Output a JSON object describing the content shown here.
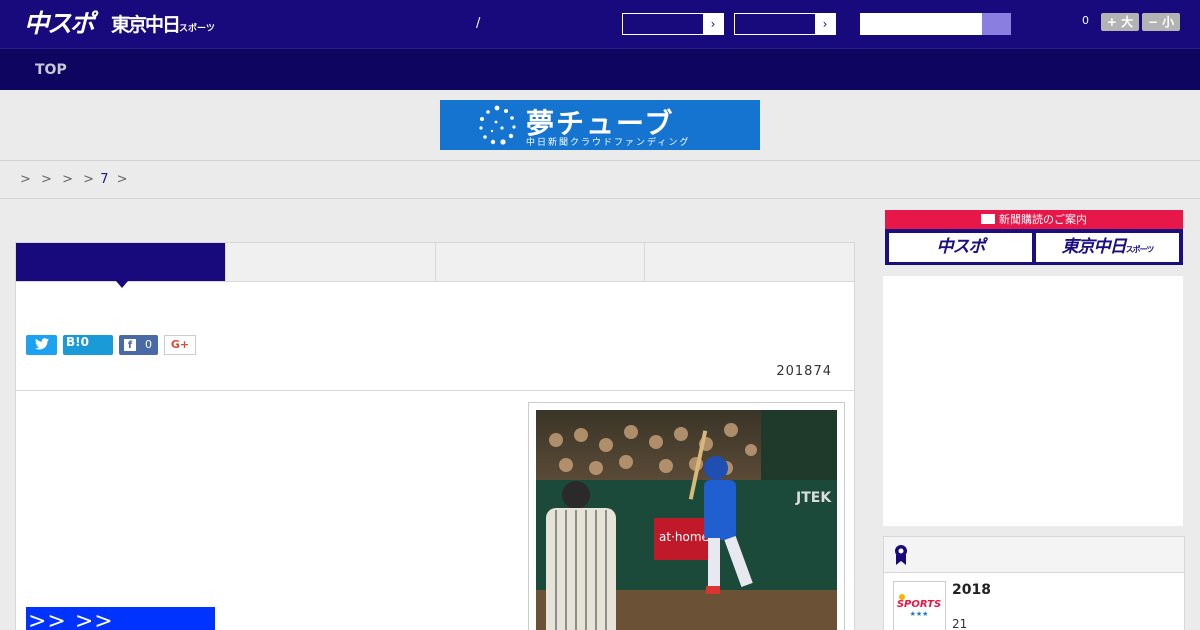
{
  "header": {
    "logo_main": "中スポ",
    "logo_sub": "東京中日",
    "logo_sub_small": "スポーツ",
    "date_separator": "/",
    "select_arrow": "›",
    "search_placeholder": "",
    "font_count": "0",
    "font_larger_label": "+ 大",
    "font_smaller_label": "− 小"
  },
  "nav": {
    "top_label": "TOP"
  },
  "banner": {
    "title": "夢チューブ",
    "subtitle": "中日新聞クラウドファンディング"
  },
  "breadcrumb": {
    "items": [
      ">",
      ">",
      ">",
      ">"
    ],
    "link": "7",
    "tail": ">"
  },
  "share": {
    "twitter_icon": "twitter-icon",
    "hatena_label": "B!0",
    "facebook_icon": "facebook-icon",
    "facebook_glyph": "f",
    "facebook_count": "0",
    "gplus_label": "G+"
  },
  "article": {
    "date": "201874",
    "link_text": ">> >>"
  },
  "sidebar": {
    "subscribe_title": "新聞購読のご案内",
    "subscribe_logo_1": "中スポ",
    "subscribe_logo_2": "東京中日",
    "subscribe_logo_2_small": "スポーツ",
    "ranking_year": "2018",
    "ranking_sub": "21"
  },
  "colors": {
    "header_bg": "#180a7c",
    "nav_bg": "#0e0560",
    "banner_bg": "#1674d1",
    "link_blue": "#0033ff",
    "subscribe_red": "#e8174a"
  }
}
